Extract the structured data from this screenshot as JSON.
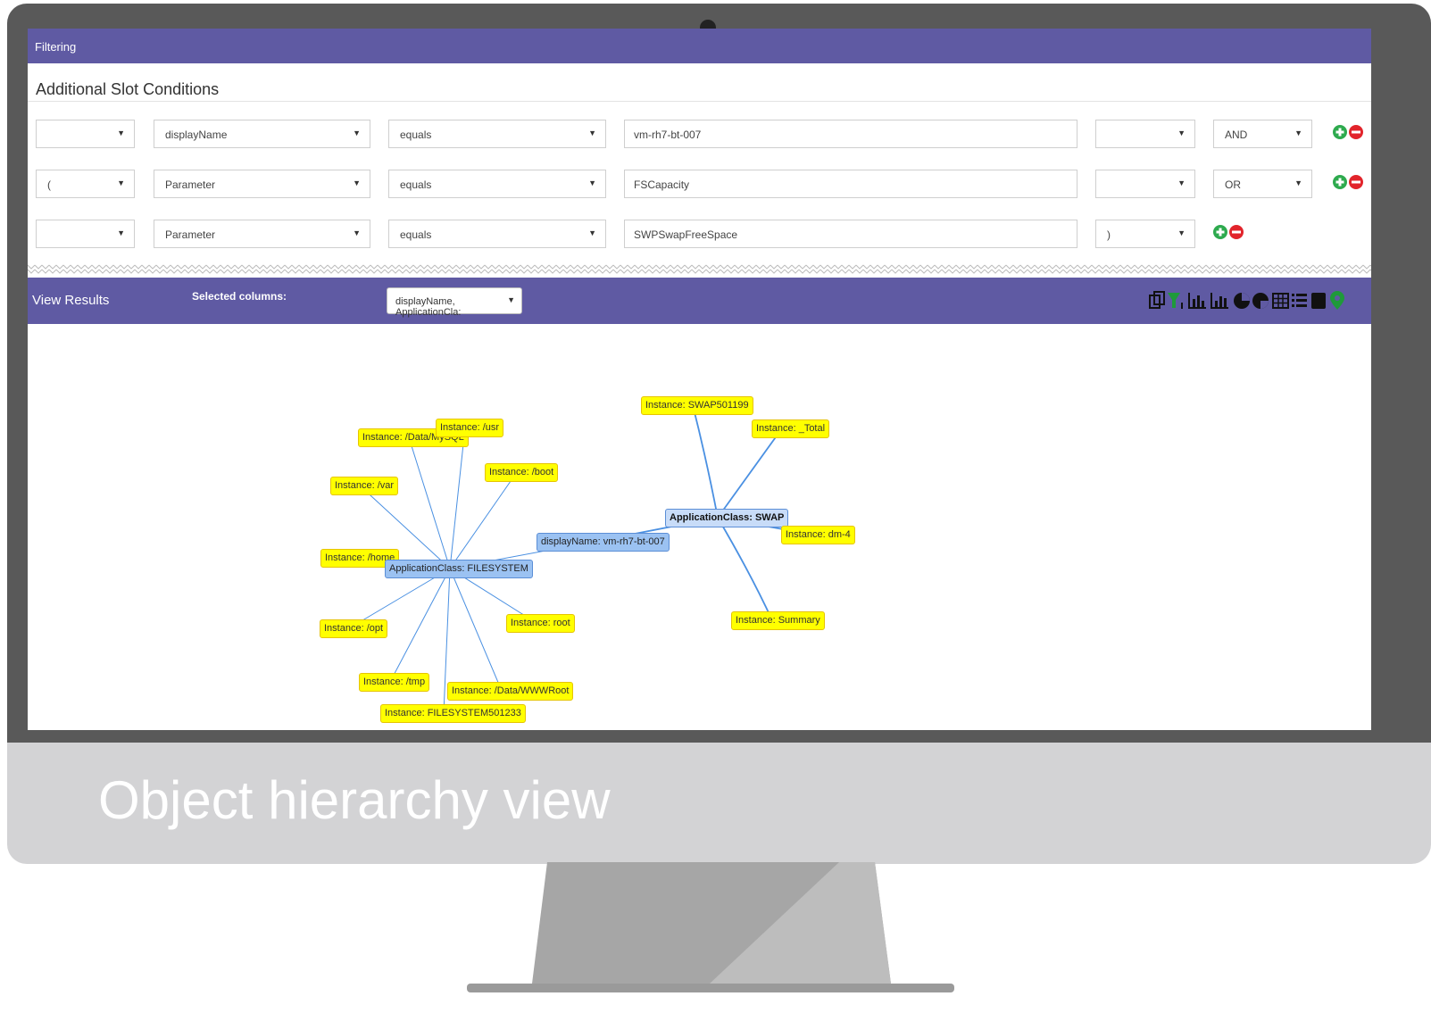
{
  "caption": "Object hierarchy view",
  "filter_header": "Filtering",
  "section_title": "Additional Slot Conditions",
  "conditions": [
    {
      "paren_open": "",
      "field": "displayName",
      "operator": "equals",
      "value": "vm-rh7-bt-007",
      "paren_close": "",
      "logic": "AND"
    },
    {
      "paren_open": "(",
      "field": "Parameter",
      "operator": "equals",
      "value": "FSCapacity",
      "paren_close": "",
      "logic": "OR"
    },
    {
      "paren_open": "",
      "field": "Parameter",
      "operator": "equals",
      "value": "SWPSwapFreeSpace",
      "paren_close": ")",
      "logic": ""
    }
  ],
  "results": {
    "title": "View Results",
    "selected_columns_label": "Selected columns:",
    "selected_columns_value": "displayName, ApplicationCla:"
  },
  "toolbar_icons": [
    "copy-icon",
    "filter-icon",
    "bar-chart-icon",
    "bar-chart-alt-icon",
    "pie-chart-icon",
    "pie-chart-alt-icon",
    "table-icon",
    "list-icon",
    "square-icon",
    "map-pin-icon"
  ],
  "colors": {
    "purple": "#5f5aa3",
    "node_yellow": "#ffff00",
    "node_blue": "#9bc2f2",
    "edge_blue": "#4a90e2",
    "add_green": "#2eaa4e",
    "remove_red": "#e2242b"
  },
  "graph": {
    "root": "displayName: vm-rh7-bt-007",
    "fs_class": "ApplicationClass: FILESYSTEM",
    "swap_class": "ApplicationClass: SWAP",
    "fs_instances": [
      "Instance: /Data/MySQL",
      "Instance: /usr",
      "Instance: /boot",
      "Instance: /var",
      "Instance: /home",
      "Instance: /opt",
      "Instance: root",
      "Instance: /tmp",
      "Instance: /Data/WWWRoot",
      "Instance: FILESYSTEM501233"
    ],
    "swap_instances": [
      "Instance: SWAP501199",
      "Instance: _Total",
      "Instance: dm-4",
      "Instance: Summary"
    ]
  }
}
